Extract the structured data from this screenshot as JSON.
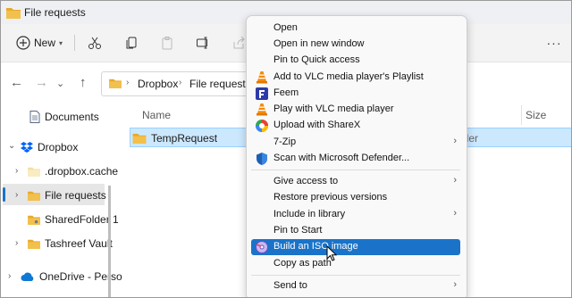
{
  "window": {
    "title": "File requests"
  },
  "toolbar": {
    "new_label": "New"
  },
  "address": {
    "crumbs": [
      "Dropbox",
      "File requests"
    ]
  },
  "sidebar": {
    "items": [
      {
        "label": "Documents"
      },
      {
        "label": "Dropbox"
      },
      {
        "label": ".dropbox.cache"
      },
      {
        "label": "File requests"
      },
      {
        "label": "SharedFolder 1"
      },
      {
        "label": "Tashreef Vault"
      },
      {
        "label": "OneDrive - Perso"
      }
    ]
  },
  "content": {
    "columns": {
      "name": "Name",
      "size": "Size"
    },
    "row": {
      "name": "TempRequest",
      "type_fragment": "lder"
    }
  },
  "context_menu": {
    "items": [
      {
        "label": "Open"
      },
      {
        "label": "Open in new window"
      },
      {
        "label": "Pin to Quick access"
      },
      {
        "label": "Add to VLC media player's Playlist"
      },
      {
        "label": "Feem"
      },
      {
        "label": "Play with VLC media player"
      },
      {
        "label": "Upload with ShareX"
      },
      {
        "label": "7-Zip"
      },
      {
        "label": "Scan with Microsoft Defender..."
      },
      {
        "label": "Give access to"
      },
      {
        "label": "Restore previous versions"
      },
      {
        "label": "Include in library"
      },
      {
        "label": "Pin to Start"
      },
      {
        "label": "Build an ISO image"
      },
      {
        "label": "Copy as path"
      },
      {
        "label": "Send to"
      }
    ]
  },
  "colors": {
    "accent": "#1a73c9",
    "selection": "#cce8ff",
    "folder": "#f2c04c"
  }
}
